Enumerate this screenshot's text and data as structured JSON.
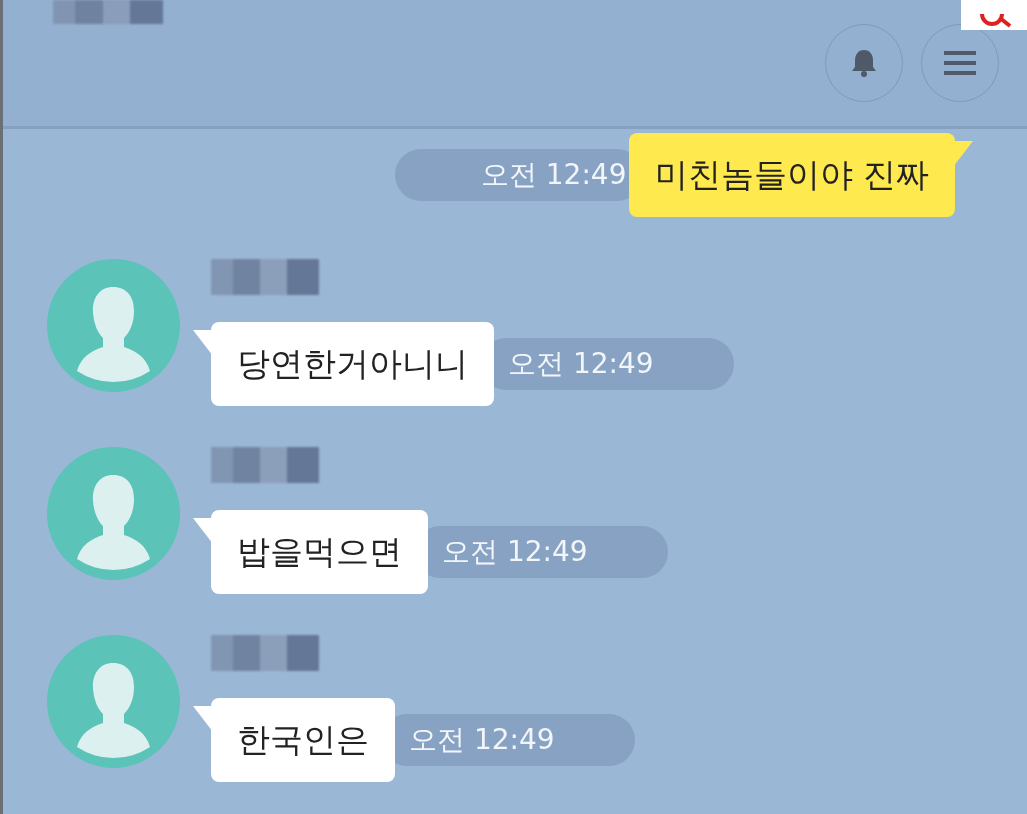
{
  "header": {
    "buttons": [
      {
        "kind": "bell"
      },
      {
        "kind": "menu"
      }
    ]
  },
  "messages": [
    {
      "kind": "sent",
      "text": "미친놈들이야 진짜",
      "time": "오전 12:49"
    },
    {
      "kind": "received",
      "text": "당연한거아니니",
      "time": "오전 12:49"
    },
    {
      "kind": "received",
      "text": "밥을먹으면",
      "time": "오전 12:49"
    },
    {
      "kind": "received",
      "text": "한국인은",
      "time": "오전 12:49"
    }
  ]
}
